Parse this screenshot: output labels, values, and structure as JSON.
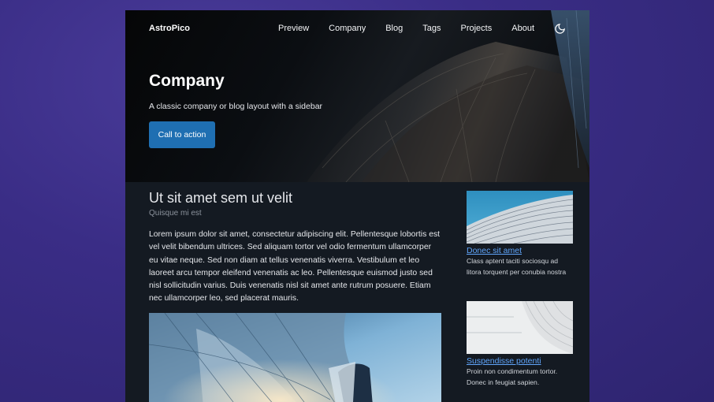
{
  "nav": {
    "brand": "AstroPico",
    "links": [
      "Preview",
      "Company",
      "Blog",
      "Tags",
      "Projects",
      "About"
    ],
    "theme_icon": "moon-icon"
  },
  "hero": {
    "title": "Company",
    "subtitle": "A classic company or blog layout with a sidebar",
    "cta_label": "Call to action"
  },
  "main": {
    "title": "Ut sit amet sem ut velit",
    "subtitle": "Quisque mi est",
    "body": "Lorem ipsum dolor sit amet, consectetur adipiscing elit. Pellentesque lobortis est vel velit bibendum ultrices. Sed aliquam tortor vel odio fermentum ullamcorper eu vitae neque. Sed non diam at tellus venenatis viverra. Vestibulum et leo laoreet arcu tempor eleifend venenatis ac leo. Pellentesque euismod justo sed nisl sollicitudin varius. Duis venenatis nisl sit amet ante rutrum posuere. Etiam nec ullamcorper leo, sed placerat mauris."
  },
  "sidebar": {
    "items": [
      {
        "title": "Donec sit amet",
        "text": "Class aptent taciti sociosqu ad litora torquent per conubia nostra"
      },
      {
        "title": "Suspendisse potenti",
        "text": "Proin non condimentum tortor. Donec in feugiat sapien."
      }
    ]
  },
  "colors": {
    "accent": "#1f6fb2",
    "link": "#60a5fa",
    "background": "#141a22",
    "page": "#3a2d86"
  }
}
